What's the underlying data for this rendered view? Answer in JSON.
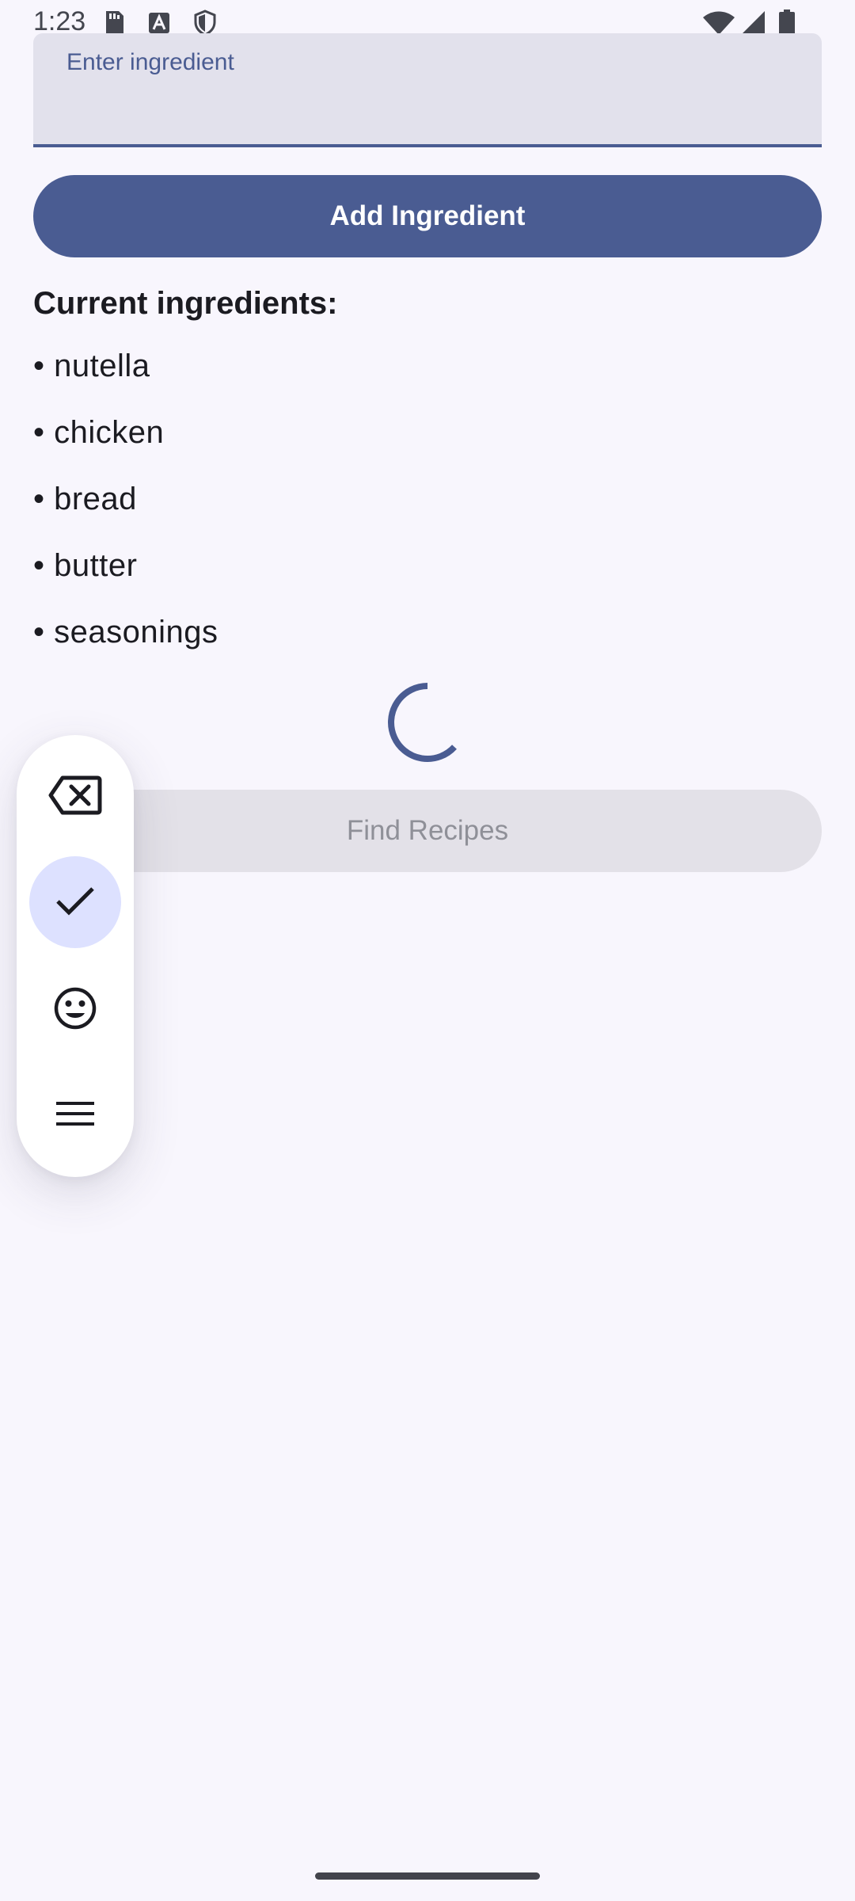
{
  "status_bar": {
    "time": "1:23",
    "icons_left": [
      "sd-card-icon",
      "a-icon",
      "shield-icon"
    ],
    "icons_right": [
      "wifi-icon",
      "cellular-signal-icon",
      "battery-icon"
    ]
  },
  "ingredient_input": {
    "label": "Enter ingredient",
    "value": ""
  },
  "add_button": {
    "label": "Add Ingredient"
  },
  "ingredients": {
    "heading": "Current ingredients:",
    "items": [
      "• nutella",
      "• chicken",
      "• bread",
      "• butter",
      "• seasonings"
    ]
  },
  "loading": {
    "icon": "loading-spinner-icon"
  },
  "find_button": {
    "label": "Find Recipes",
    "enabled": false
  },
  "floating_toolbar": {
    "buttons": [
      {
        "icon": "backspace-icon",
        "active": false
      },
      {
        "icon": "check-icon",
        "active": true
      },
      {
        "icon": "emoji-icon",
        "active": false
      },
      {
        "icon": "menu-icon",
        "active": false
      }
    ]
  },
  "colors": {
    "primary": "#4a5c92",
    "background": "#f8f6fd",
    "field_background": "#e2e1ec",
    "disabled_button": "#e3e1e8",
    "active_tool": "#dde1ff"
  }
}
